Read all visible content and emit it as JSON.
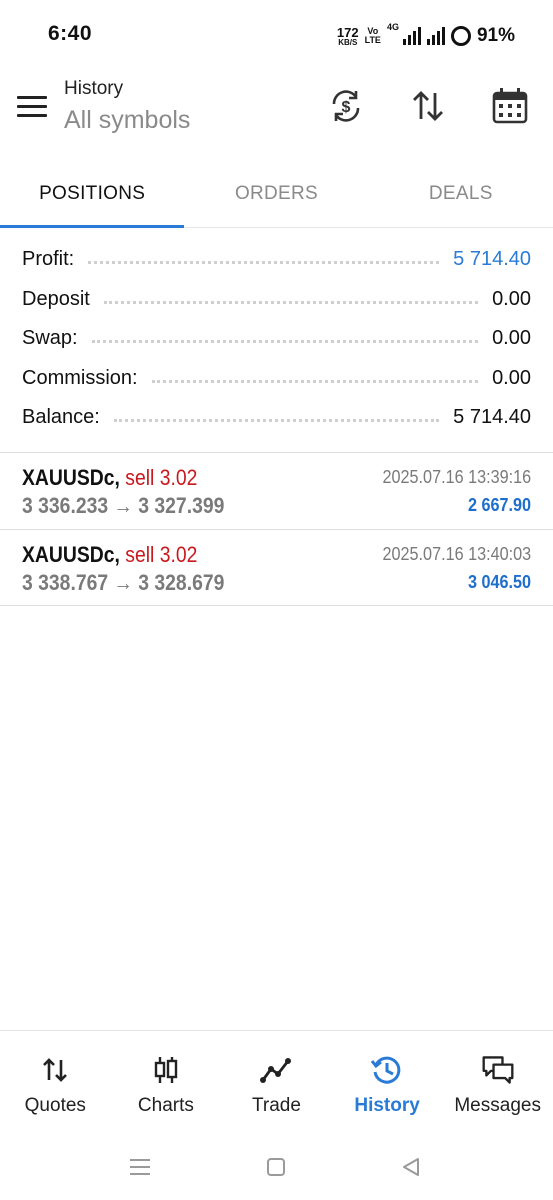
{
  "status_bar": {
    "time": "6:40",
    "net_speed_value": "172",
    "net_speed_unit": "KB/S",
    "volte_top": "Vo",
    "volte_bottom": "LTE",
    "network_tag": "4G",
    "battery": "91%"
  },
  "app_bar": {
    "title": "History",
    "subtitle": "All symbols",
    "icons": [
      "menu-icon",
      "currency-exchange-icon",
      "sort-icon",
      "calendar-icon"
    ]
  },
  "tabs": [
    {
      "label": "POSITIONS",
      "active": true
    },
    {
      "label": "ORDERS",
      "active": false
    },
    {
      "label": "DEALS",
      "active": false
    }
  ],
  "summary": [
    {
      "label": "Profit:",
      "value": "5 714.40",
      "highlight": true
    },
    {
      "label": "Deposit",
      "value": "0.00",
      "highlight": false
    },
    {
      "label": "Swap:",
      "value": "0.00",
      "highlight": false
    },
    {
      "label": "Commission:",
      "value": "0.00",
      "highlight": false
    },
    {
      "label": "Balance:",
      "value": "5 714.40",
      "highlight": false
    }
  ],
  "deals": [
    {
      "symbol": "XAUUSDc,",
      "side": "sell 3.02",
      "prices": "3 336.233 → 3 327.399",
      "time": "2025.07.16 13:39:16",
      "profit": "2 667.90"
    },
    {
      "symbol": "XAUUSDc,",
      "side": "sell 3.02",
      "prices": "3 338.767 → 3 328.679",
      "time": "2025.07.16 13:40:03",
      "profit": "3 046.50"
    }
  ],
  "bottom_nav": [
    {
      "label": "Quotes",
      "icon": "quotes-icon",
      "active": false
    },
    {
      "label": "Charts",
      "icon": "candlestick-icon",
      "active": false
    },
    {
      "label": "Trade",
      "icon": "trade-line-icon",
      "active": false
    },
    {
      "label": "History",
      "icon": "history-icon",
      "active": true
    },
    {
      "label": "Messages",
      "icon": "messages-icon",
      "active": false
    }
  ],
  "colors": {
    "accent": "#2a7bd6",
    "sell": "#c8191e",
    "profit": "#1e6fcc",
    "muted": "#8a8a8a"
  }
}
